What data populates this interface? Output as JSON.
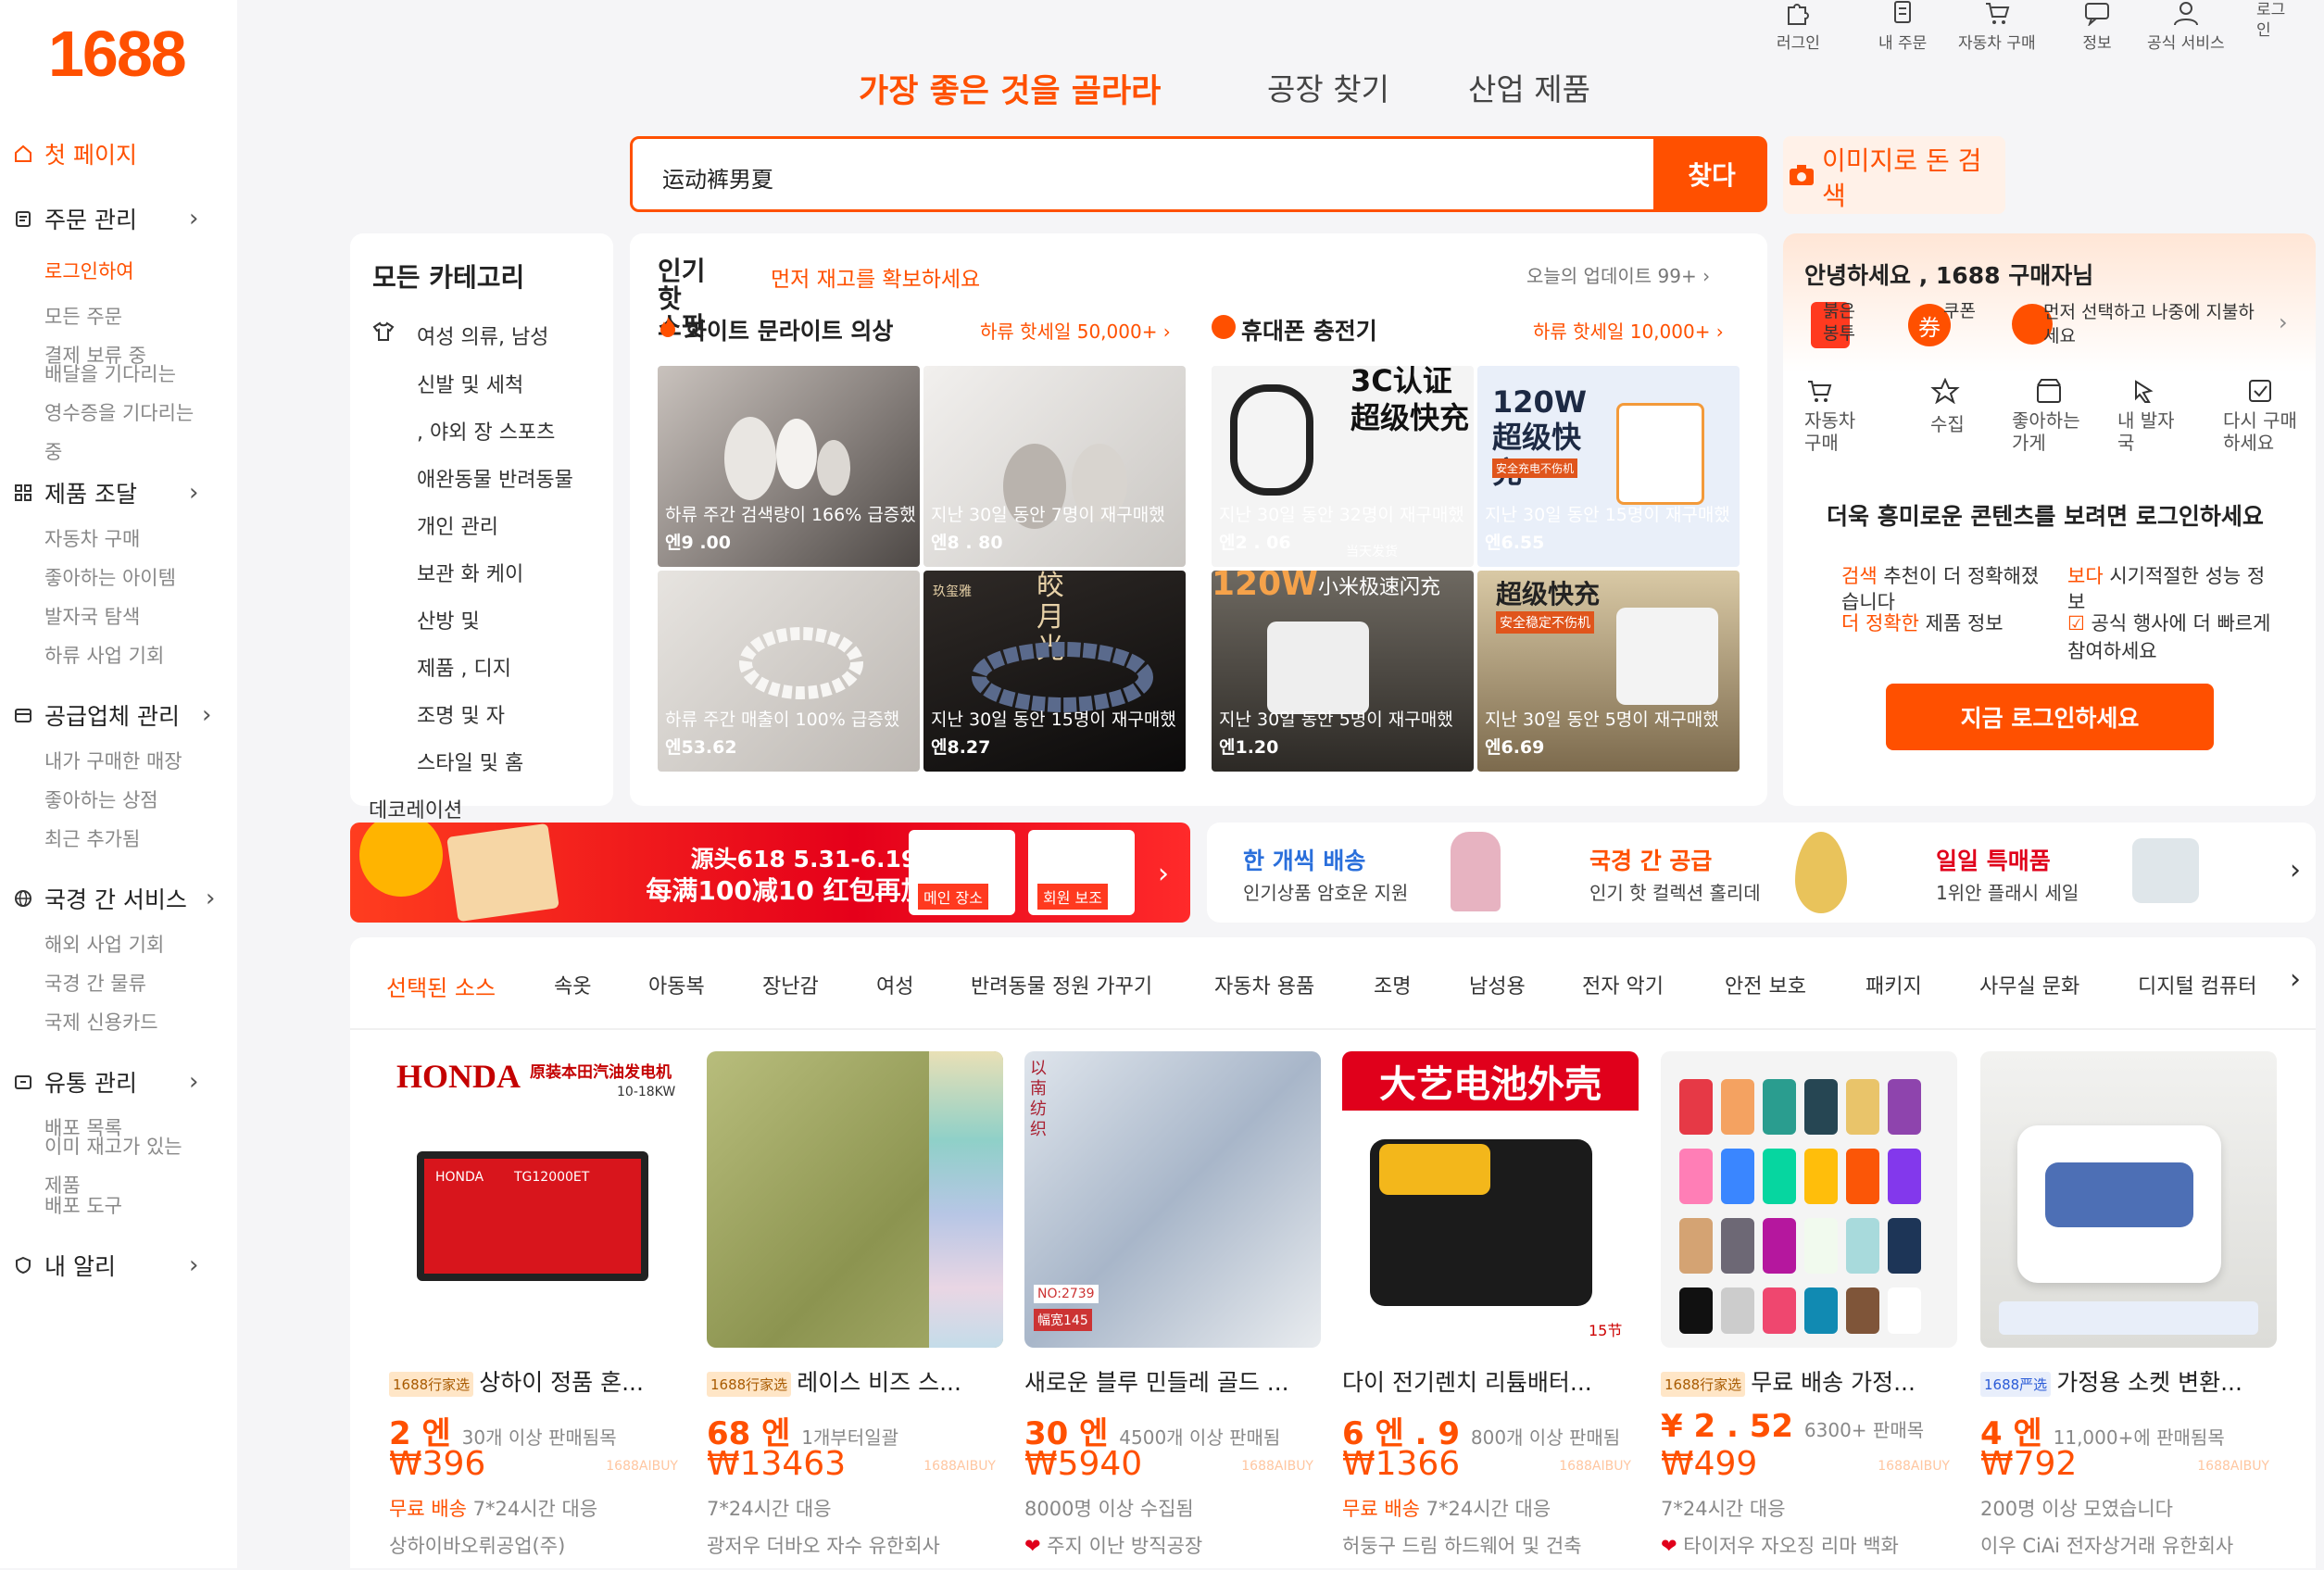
{
  "brand": {
    "logo": "1688",
    "accent": "#ff5000"
  },
  "sidebar": {
    "home": "첫 페이지",
    "groups": [
      {
        "label": "주문 관리",
        "items": [
          "로그인하여",
          "모든 주문",
          "결제 보류 중",
          "배달을 기다리는",
          "영수증을 기다리는",
          "중"
        ]
      },
      {
        "label": "제품 조달",
        "items": [
          "자동차 구매",
          "좋아하는 아이템",
          "발자국 탐색",
          "하류 사업 기회"
        ]
      },
      {
        "label": "공급업체 관리",
        "items": [
          "내가 구매한 매장",
          "좋아하는 상점",
          "최근 추가됨"
        ]
      },
      {
        "label": "국경 간 서비스",
        "items": [
          "해외 사업 기회",
          "국경 간 물류",
          "국제 신용카드"
        ]
      },
      {
        "label": "유통 관리",
        "items": [
          "배포 목록",
          "이미 재고가 있는",
          "제품",
          "배포 도구"
        ]
      },
      {
        "label": "내 알리",
        "items": []
      }
    ]
  },
  "topnav": [
    "러그인",
    "내 주문",
    "자동차 구매",
    "정보",
    "공식 서비스",
    "로그인"
  ],
  "search": {
    "tabs": [
      "가장 좋은 것을 골라라",
      "공장 찾기",
      "산업 제품"
    ],
    "query": "运动裤男夏",
    "button": "찾다",
    "image_search": "이미지로 돈 검색"
  },
  "categories": {
    "title": "모든 카테고리",
    "rows": [
      "여성 의류, 남성",
      "신발 및 세척",
      ", 야외 장 스포츠",
      "애완동물 반려동물",
      "개인 관리",
      "보관 화 케이",
      "산방 및",
      "제품 , 디지",
      "조명 및 자",
      "스타일 및 홈",
      "데코레이션"
    ]
  },
  "hot": {
    "title": "인기 핫 스팟",
    "sub": "먼저 재고를 확보하세요",
    "update": "오늘의 업데이트 99+",
    "left": {
      "name": "화이트 문라이트 의상",
      "stat": "하류 핫세일 50,000+"
    },
    "right": {
      "name": "휴대폰 충전기",
      "stat": "하류 핫세일 10,000+"
    },
    "tiles": [
      {
        "cap": "하류 주간 검색량이 166% 급증했",
        "price": "엔9 .00"
      },
      {
        "cap": "지난 30일 동안 7명이 재구매했",
        "price": "엔8 . 80"
      },
      {
        "cap": "지난 30일 동안 32명이 재구매했",
        "price": "엔2 . 06"
      },
      {
        "cap": "지난 30일 동안 15명이 재구매했",
        "price": "엔6.55"
      },
      {
        "cap": "하류 주간 매출이 100% 급증했",
        "price": "엔53.62"
      },
      {
        "cap": "지난 30일 동안 15명이 재구매했",
        "price": "엔8.27"
      },
      {
        "cap": "지난 30일 동안 5명이 재구매했",
        "price": "엔1.20"
      },
      {
        "cap": "지난 30일 동안 5명이 재구매했",
        "price": "엔6.69"
      }
    ]
  },
  "account": {
    "greeting": "안녕하세요 , 1688 구매자님",
    "perks": [
      "붉은 봉투",
      "쿠폰",
      "먼저 선택하고 나중에 지불하세요"
    ],
    "shortcuts": [
      "자동차 구매",
      "수집",
      "좋아하는 가게",
      "내 발자국",
      "다시 구매하세요"
    ],
    "prompt": "더욱 흥미로운 콘텐츠를 보려면 로그인하세요",
    "features": [
      {
        "key": "검색",
        "text": "추천이 더 정확해졌습니다"
      },
      {
        "key": "보다",
        "text": "시기적절한 성능 정보"
      },
      {
        "key": "더 정확한",
        "text": "제품 정보"
      },
      {
        "key": "",
        "text": "공식 행사에 더 빠르게 참여하세요"
      }
    ],
    "login_button": "지금 로그인하세요"
  },
  "promo": {
    "banner": "源头618 5.31-6.19",
    "banner2": "每满100减10 红包再加补",
    "chip1": "메인 장소",
    "chip2": "회원 보조",
    "pills": [
      {
        "title": "한 개씩 배송",
        "sub": "인기상품 암호운 지원",
        "color": "#2a6fdb"
      },
      {
        "title": "국경 간 공급",
        "sub": "인기 핫 컬렉션 홀리데",
        "color": "#ff5000"
      },
      {
        "title": "일일 특매품",
        "sub": "1위안 플래시 세일",
        "color": "#e0001b"
      }
    ]
  },
  "category_tabs": [
    "선택된 소스",
    "속옷",
    "아동복",
    "장난감",
    "여성",
    "반려동물 정원 가꾸기",
    "자동차 용품",
    "조명",
    "남성용",
    "전자 악기",
    "안전 보호",
    "패키지",
    "사무실 문화",
    "디지털 컴퓨터"
  ],
  "products": [
    {
      "tag": "1688行家选",
      "title": "상하이 정품 혼...",
      "p1": "2 엔",
      "p1_note": "30개 이상 판매됨목",
      "p2": "₩396",
      "svc_hl": "무료 배송",
      "svc": "7*24시간 대응",
      "seller": "상하이바오뤼공업(주)",
      "wm": "1688AIBUY"
    },
    {
      "tag": "1688行家选",
      "title": "레이스 비즈 스...",
      "p1": "68 엔",
      "p1_note": "1개부터일괄",
      "p2": "₩13463",
      "svc_hl": "",
      "svc": "7*24시간 대응",
      "seller": "광저우 더바오 자수 유한회사",
      "wm": "1688AIBUY"
    },
    {
      "tag": "",
      "title": "새로운 블루 민들레 골드 ...",
      "p1": "30 엔",
      "p1_note": "4500개 이상 판매됨",
      "p2": "₩5940",
      "svc_hl": "",
      "svc": "8000명 이상 수집됨",
      "seller": "주지 이난 방직공장",
      "wm": "1688AIBUY"
    },
    {
      "tag": "",
      "title": "다이 전기렌치 리튬배터...",
      "p1": "6 엔 . 9",
      "p1_note": "800개 이상 판매됨",
      "p2": "₩1366",
      "svc_hl": "무료 배송",
      "svc": "7*24시간 대응",
      "seller": "허둥구 드림 하드웨어 및 건축",
      "wm": "1688AIBUY"
    },
    {
      "tag": "1688行家选",
      "title": "무료 배송 가정...",
      "p1": "¥ 2 . 52",
      "p1_note": "6300+ 판매목",
      "p2": "₩499",
      "svc_hl": "",
      "svc": "7*24시간 대응",
      "seller": "타이저우 자오징 리마 백화",
      "wm": "1688AIBUY"
    },
    {
      "tag": "1688严选",
      "title": "가정용 소켓 변환...",
      "p1": "4 엔",
      "p1_note": "11,000+에 판매됨목",
      "p2": "₩792",
      "svc_hl": "",
      "svc": "200명 이상 모였습니다",
      "seller": "이우 CiAi 전자상거래 유한회사",
      "wm": "1688AIBUY"
    }
  ],
  "product_images": [
    "HONDA",
    "原装本田汽油发电机",
    "10-18KW",
    "TG12000ET",
    "以南纺织",
    "NO:2739",
    "幅宽145",
    "大艺电池外壳",
    "15节",
    "3C认证 超级快充",
    "120W 超级快充",
    "安全充电不伤机",
    "小米极速闪充",
    "超级快充",
    "安全稳定不伤机",
    "当天发货",
    "玖玺雅",
    "皎月光"
  ]
}
